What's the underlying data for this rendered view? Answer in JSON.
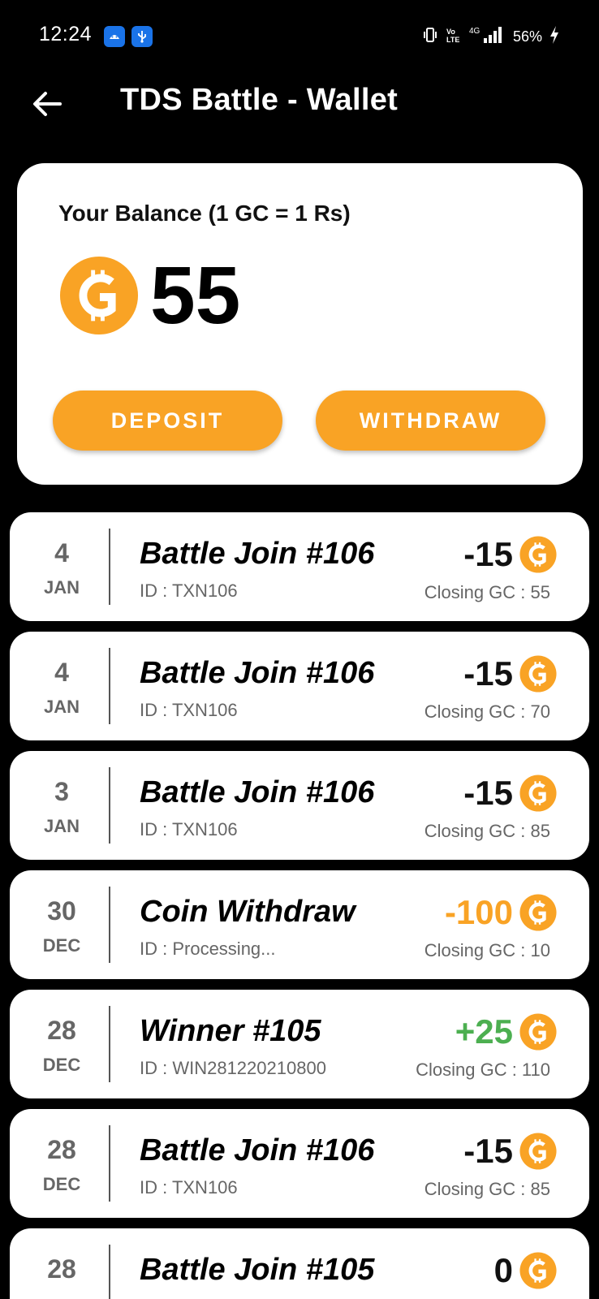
{
  "status_bar": {
    "time": "12:24",
    "battery": "56%",
    "network": "4G",
    "icons": [
      "android-icon",
      "usb-icon",
      "vibrate-icon",
      "volte-icon",
      "signal-icon",
      "charging-icon"
    ]
  },
  "app_bar": {
    "title": "TDS Battle - Wallet",
    "back_icon": "back-arrow-icon"
  },
  "balance": {
    "label": "Your Balance (1 GC = 1 Rs)",
    "amount": "55",
    "deposit_label": "DEPOSIT",
    "withdraw_label": "WITHDRAW"
  },
  "colors": {
    "accent": "#f9a325",
    "positive": "#4caf50",
    "background": "#000000",
    "card": "#ffffff"
  },
  "transactions": [
    {
      "day": "4",
      "month": "JAN",
      "title": "Battle Join #106",
      "id": "ID : TXN106",
      "amount": "-15",
      "amount_style": "neutral",
      "closing": "Closing GC : 55"
    },
    {
      "day": "4",
      "month": "JAN",
      "title": "Battle Join #106",
      "id": "ID : TXN106",
      "amount": "-15",
      "amount_style": "neutral",
      "closing": "Closing GC : 70"
    },
    {
      "day": "3",
      "month": "JAN",
      "title": "Battle Join #106",
      "id": "ID : TXN106",
      "amount": "-15",
      "amount_style": "neutral",
      "closing": "Closing GC : 85"
    },
    {
      "day": "30",
      "month": "DEC",
      "title": "Coin Withdraw",
      "id": "ID : Processing...",
      "amount": "-100",
      "amount_style": "orange",
      "closing": "Closing GC : 10"
    },
    {
      "day": "28",
      "month": "DEC",
      "title": "Winner #105",
      "id": "ID : WIN281220210800",
      "amount": "+25",
      "amount_style": "green",
      "closing": "Closing GC : 110"
    },
    {
      "day": "28",
      "month": "DEC",
      "title": "Battle Join #106",
      "id": "ID : TXN106",
      "amount": "-15",
      "amount_style": "neutral",
      "closing": "Closing GC : 85"
    },
    {
      "day": "28",
      "month": "",
      "title": "Battle Join #105",
      "id": "",
      "amount": "0",
      "amount_style": "neutral",
      "closing": ""
    }
  ]
}
